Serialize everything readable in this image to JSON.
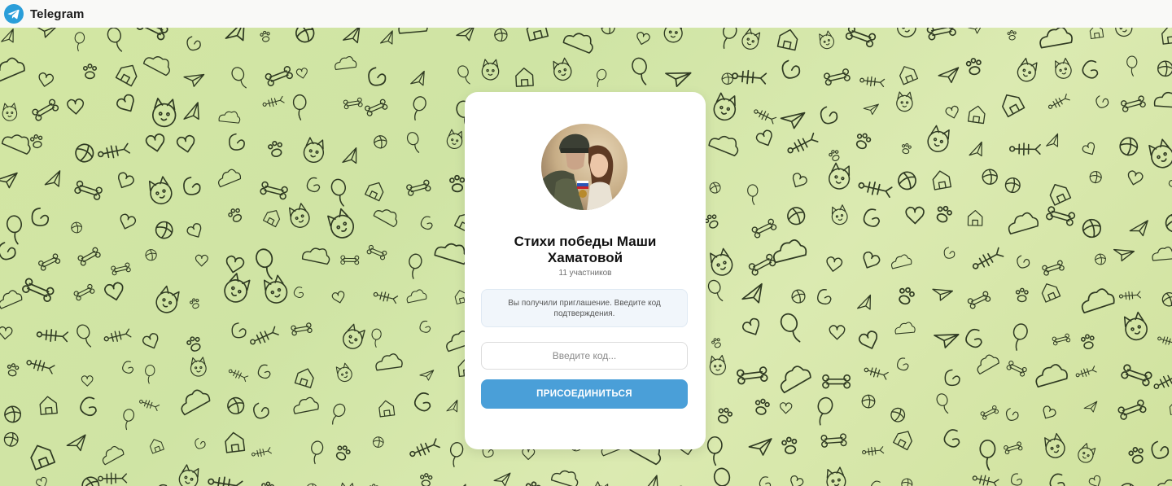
{
  "header": {
    "brand_name": "Telegram",
    "logo_icon": "telegram-logo-icon",
    "logo_color": "#2a9ed9"
  },
  "background": {
    "pattern": "doodle-pattern",
    "color": "#d3e6a3",
    "line_color": "#2f3a22"
  },
  "channel": {
    "title": "Стихи победы Маши Хаматовой",
    "members": "11 участников",
    "avatar": "channel-avatar"
  },
  "invite": {
    "notice": "Вы получили приглашение. Введите код подтверждения.",
    "code_placeholder": "Введите код...",
    "code_value": "",
    "join_label": "ПРИСОЕДИНИТЬСЯ",
    "join_color": "#4a9fd8"
  }
}
